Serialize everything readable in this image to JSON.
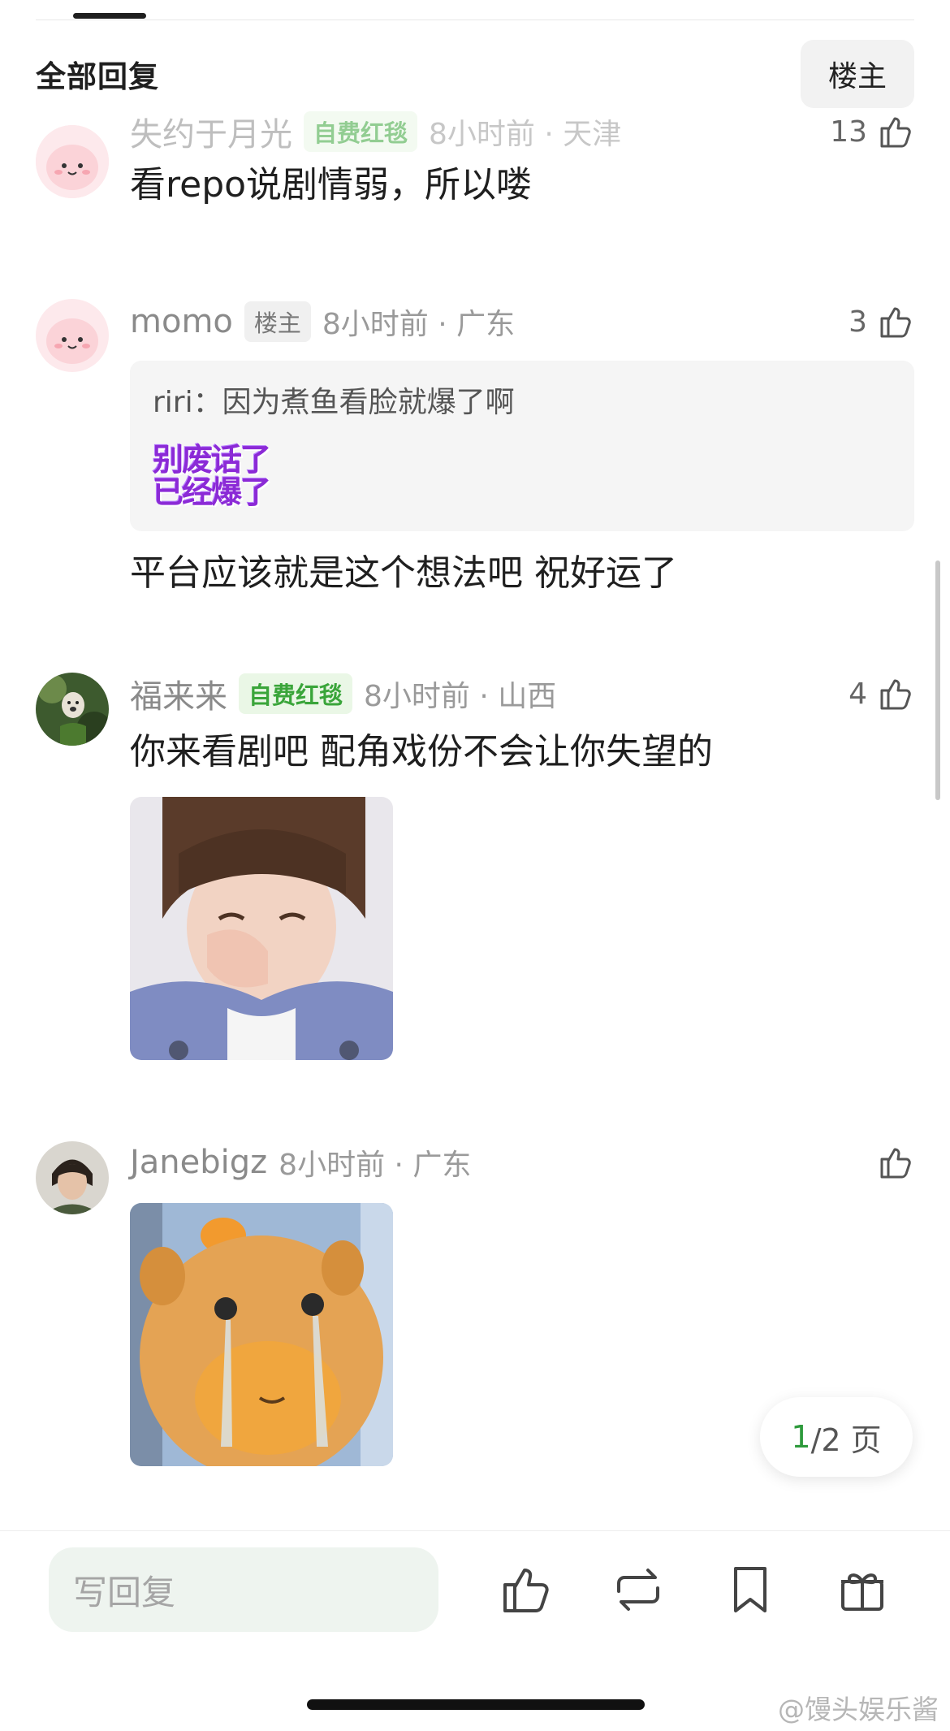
{
  "header": {
    "title": "全部回复",
    "op_filter": "楼主"
  },
  "comments": [
    {
      "username": "失约于月光",
      "badge": "自费红毯",
      "time": "8小时前 · 天津",
      "likes": "13",
      "text": "看repo说剧情弱，所以喽"
    },
    {
      "username": "momo",
      "badge": "楼主",
      "time": "8小时前 · 广东",
      "likes": "3",
      "quote": "riri：因为煮鱼看脸就爆了啊",
      "sticker_text": [
        "别废话了",
        "已经爆了"
      ],
      "text": "平台应该就是这个想法吧 祝好运了"
    },
    {
      "username": "福来来",
      "badge": "自费红毯",
      "time": "8小时前 · 山西",
      "likes": "4",
      "text": "你来看剧吧 配角戏份不会让你失望的"
    },
    {
      "username": "Janebigz",
      "badge": "",
      "time": "8小时前 · 广东",
      "likes": ""
    }
  ],
  "pager": {
    "current": "1",
    "rest": "/2 页"
  },
  "bottom": {
    "reply_placeholder": "写回复"
  },
  "watermark": "@馒头娱乐酱",
  "colors": {
    "accent_green": "#2e9a3c",
    "badge_green_bg": "#eaf7e6",
    "badge_green_text": "#3aa53a"
  }
}
